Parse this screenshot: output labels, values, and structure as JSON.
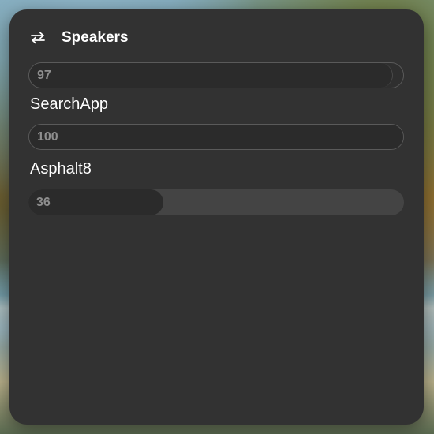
{
  "background": {
    "accent_bg": "#323232",
    "track_color": "#444444",
    "fill_color": "#2b2b2b"
  },
  "header": {
    "icon": "switch-arrows-icon",
    "title": "Speakers"
  },
  "sliders": [
    {
      "label": "",
      "value": "97",
      "level": 0.97
    },
    {
      "label": "SearchApp",
      "value": "100",
      "level": 1.0
    },
    {
      "label": "Asphalt8",
      "value": "36",
      "level": 0.36
    }
  ]
}
